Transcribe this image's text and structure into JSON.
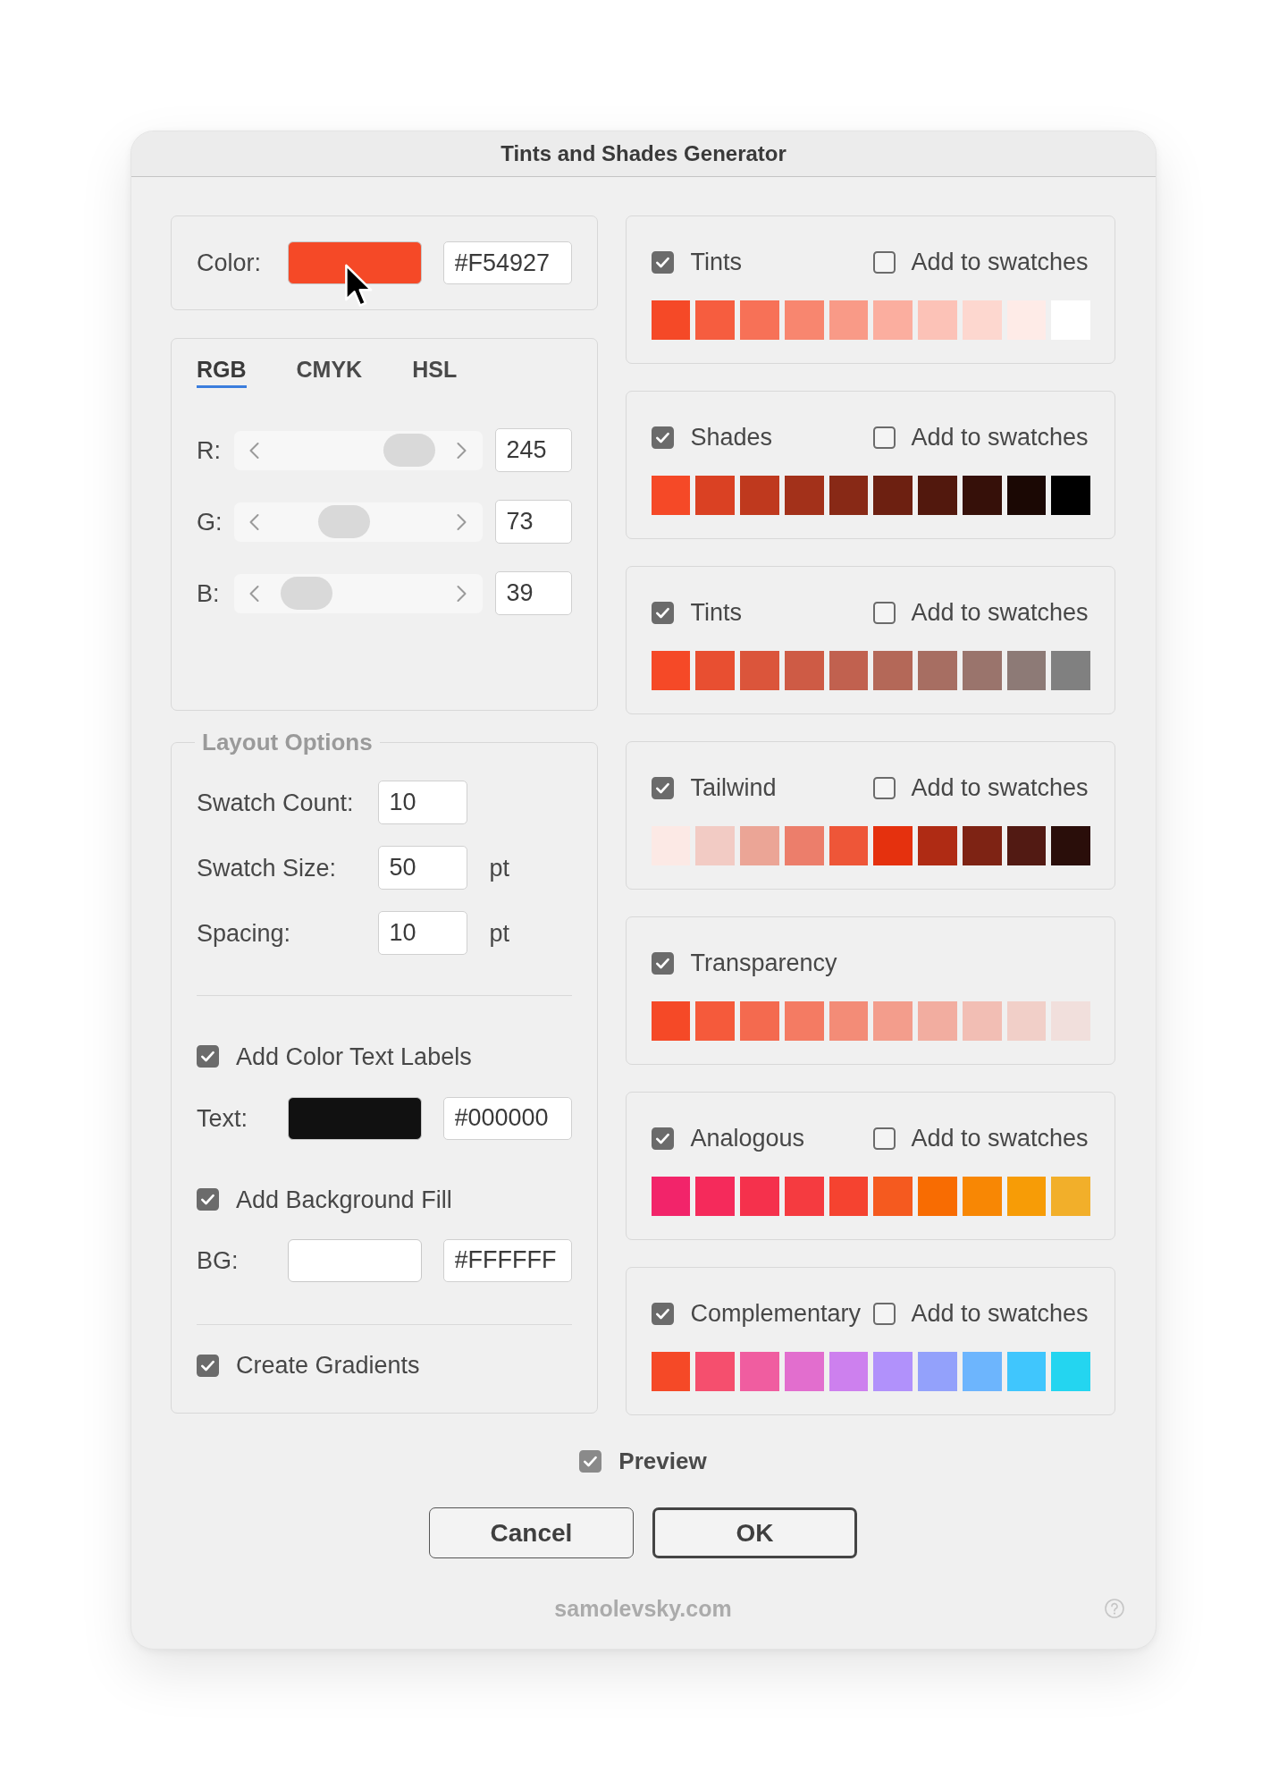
{
  "window": {
    "title": "Tints and Shades Generator"
  },
  "base_color": {
    "label": "Color:",
    "color": "#f54927",
    "hex": "#F54927"
  },
  "color_model": {
    "tabs": [
      {
        "label": "RGB",
        "selected": true
      },
      {
        "label": "CMYK",
        "selected": false
      },
      {
        "label": "HSL",
        "selected": false
      }
    ],
    "channels": [
      {
        "label": "R:",
        "level": 0.76,
        "value": "245"
      },
      {
        "label": "G:",
        "level": 0.43,
        "value": "73"
      },
      {
        "label": "B:",
        "level": 0.24,
        "value": "39"
      }
    ]
  },
  "layout_options": {
    "title": "Layout Options",
    "fields": [
      {
        "label": "Swatch Count:",
        "value": "10"
      },
      {
        "label": "Swatch Size:",
        "value": "50",
        "unit": "pt"
      },
      {
        "label": "Spacing:",
        "value": "10",
        "unit": "pt"
      }
    ],
    "text_labels": {
      "label": "Add Color Text Labels",
      "checked": true,
      "picker": {
        "label": "Text:",
        "color": "#111111",
        "hex": "#000000"
      }
    },
    "background_fill": {
      "label": "Add Background Fill",
      "checked": true,
      "picker": {
        "label": "BG:",
        "color": "#ffffff",
        "hex": "#FFFFFF"
      }
    },
    "gradients": {
      "label": "Create Gradients",
      "checked": true
    }
  },
  "panels": [
    {
      "label": "Tints",
      "checked": true,
      "add_to_swatches": {
        "label": "Add to swatches",
        "checked": false
      },
      "swatches": [
        {
          "color": "#f54927"
        },
        {
          "color": "#f65d3f"
        },
        {
          "color": "#f77157"
        },
        {
          "color": "#f8866f"
        },
        {
          "color": "#f99a87"
        },
        {
          "color": "#fbae9f"
        },
        {
          "color": "#fcc2b7"
        },
        {
          "color": "#fdd7cf"
        },
        {
          "color": "#feebe7"
        },
        {
          "color": "#ffffff"
        }
      ]
    },
    {
      "label": "Shades",
      "checked": true,
      "add_to_swatches": {
        "label": "Add to swatches",
        "checked": false
      },
      "swatches": [
        {
          "color": "#f54927"
        },
        {
          "color": "#da4123"
        },
        {
          "color": "#bf391e"
        },
        {
          "color": "#a3311a"
        },
        {
          "color": "#882916"
        },
        {
          "color": "#6d2011"
        },
        {
          "color": "#52180d"
        },
        {
          "color": "#361009"
        },
        {
          "color": "#1b0804"
        },
        {
          "color": "#000000"
        }
      ]
    },
    {
      "label": "Tints",
      "checked": true,
      "add_to_swatches": {
        "label": "Add to swatches",
        "checked": false
      },
      "swatches": [
        {
          "color": "#f54927"
        },
        {
          "color": "#e84f31"
        },
        {
          "color": "#db553b"
        },
        {
          "color": "#ce5b45"
        },
        {
          "color": "#c1614f"
        },
        {
          "color": "#b46858"
        },
        {
          "color": "#a76e62"
        },
        {
          "color": "#9a746c"
        },
        {
          "color": "#8d7a76"
        },
        {
          "color": "#808080"
        }
      ]
    },
    {
      "label": "Tailwind",
      "checked": true,
      "add_to_swatches": {
        "label": "Add to swatches",
        "checked": false
      },
      "swatches": [
        {
          "color": "#fce9e5"
        },
        {
          "color": "#f2cbc4"
        },
        {
          "color": "#eba596"
        },
        {
          "color": "#ec7e6b"
        },
        {
          "color": "#ee5638"
        },
        {
          "color": "#e5310e"
        },
        {
          "color": "#af2b14"
        },
        {
          "color": "#7e2314"
        },
        {
          "color": "#521a13"
        },
        {
          "color": "#2a0e0a"
        }
      ]
    },
    {
      "label": "Transparency",
      "checked": true,
      "swatches": [
        {
          "color": "#f54927"
        },
        {
          "color": "#f55a3b"
        },
        {
          "color": "#f46a4f"
        },
        {
          "color": "#f47b63"
        },
        {
          "color": "#f38c77"
        },
        {
          "color": "#f39d8c"
        },
        {
          "color": "#f2ada0"
        },
        {
          "color": "#f2beb4"
        },
        {
          "color": "#f1cfc8"
        },
        {
          "color": "#f1dfdc"
        }
      ]
    },
    {
      "label": "Analogous",
      "checked": true,
      "add_to_swatches": {
        "label": "Add to swatches",
        "checked": false
      },
      "swatches": [
        {
          "color": "#f2246a"
        },
        {
          "color": "#f52a5b"
        },
        {
          "color": "#f5314c"
        },
        {
          "color": "#f53b40"
        },
        {
          "color": "#f54330"
        },
        {
          "color": "#f55a1f"
        },
        {
          "color": "#f86c02"
        },
        {
          "color": "#f88704"
        },
        {
          "color": "#f79c06"
        },
        {
          "color": "#f2af2a"
        }
      ]
    },
    {
      "label": "Complementary",
      "checked": true,
      "add_to_swatches": {
        "label": "Add to swatches",
        "checked": false
      },
      "swatches": [
        {
          "color": "#f54927"
        },
        {
          "color": "#f54f6e"
        },
        {
          "color": "#f05da0"
        },
        {
          "color": "#e26ece"
        },
        {
          "color": "#cd80ee"
        },
        {
          "color": "#b191fb"
        },
        {
          "color": "#93a1fb"
        },
        {
          "color": "#6db5fd"
        },
        {
          "color": "#40c6fd"
        },
        {
          "color": "#24d5f0"
        }
      ]
    }
  ],
  "preview": {
    "label": "Preview",
    "checked": true
  },
  "buttons": [
    {
      "label": "Cancel",
      "default": false
    },
    {
      "label": "OK",
      "default": true
    }
  ],
  "footer": {
    "text": "samolevsky.com"
  }
}
